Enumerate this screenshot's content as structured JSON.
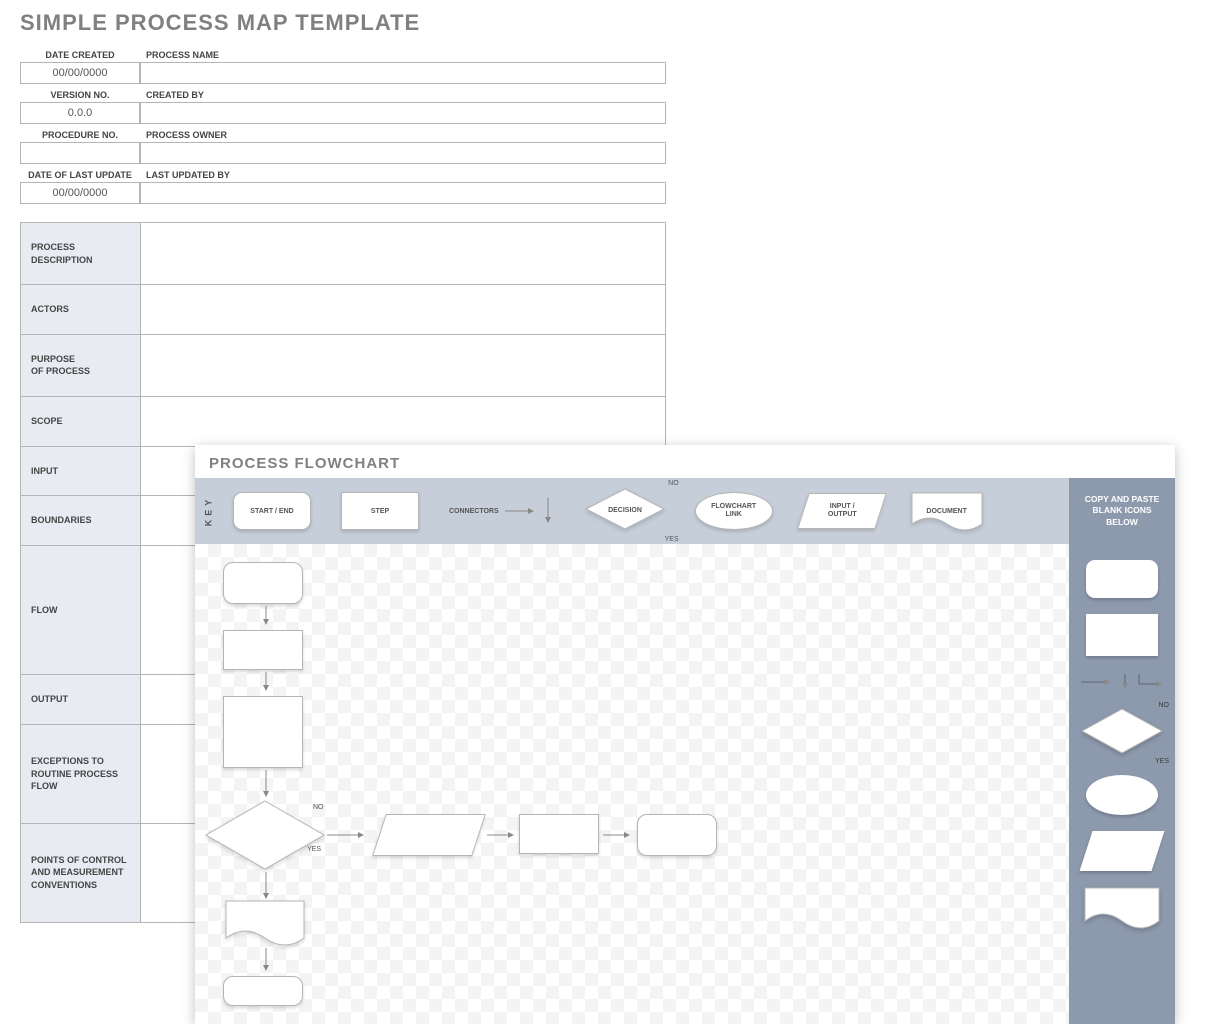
{
  "title": "SIMPLE PROCESS MAP TEMPLATE",
  "meta": {
    "labels": {
      "date_created": "DATE CREATED",
      "process_name": "PROCESS NAME",
      "version_no": "VERSION NO.",
      "created_by": "CREATED BY",
      "procedure_no": "PROCEDURE NO.",
      "process_owner": "PROCESS OWNER",
      "date_last_update": "DATE OF LAST UPDATE",
      "last_updated_by": "LAST UPDATED BY"
    },
    "values": {
      "date_created": "00/00/0000",
      "process_name": "",
      "version_no": "0.0.0",
      "created_by": "",
      "procedure_no": "",
      "process_owner": "",
      "date_last_update": "00/00/0000",
      "last_updated_by": ""
    }
  },
  "desc_rows": [
    {
      "label": "PROCESS\nDESCRIPTION",
      "value": ""
    },
    {
      "label": "ACTORS",
      "value": ""
    },
    {
      "label": "PURPOSE\nOF PROCESS",
      "value": ""
    },
    {
      "label": "SCOPE",
      "value": ""
    },
    {
      "label": "INPUT",
      "value": ""
    },
    {
      "label": "BOUNDARIES",
      "value": ""
    },
    {
      "label": "FLOW",
      "value": ""
    },
    {
      "label": "OUTPUT",
      "value": ""
    },
    {
      "label": "EXCEPTIONS TO\nROUTINE PROCESS FLOW",
      "value": ""
    },
    {
      "label": "POINTS OF CONTROL\nAND MEASUREMENT\nCONVENTIONS",
      "value": ""
    }
  ],
  "flowchart": {
    "title": "PROCESS FLOWCHART",
    "key_label": "KEY",
    "key": {
      "start_end": "START / END",
      "step": "STEP",
      "connectors": "CONNECTORS",
      "decision": "DECISION",
      "no": "NO",
      "yes": "YES",
      "flowchart_link": "FLOWCHART\nLINK",
      "input_output": "INPUT /\nOUTPUT",
      "document": "DOCUMENT"
    },
    "copy_paste": "COPY AND PASTE\nBLANK ICONS\nBELOW",
    "canvas": {
      "no": "NO",
      "yes": "YES"
    },
    "palette_labels": {
      "no": "NO",
      "yes": "YES"
    }
  }
}
